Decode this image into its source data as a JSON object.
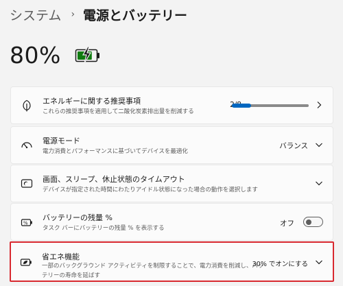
{
  "breadcrumb": {
    "parent": "システム",
    "separator": "›",
    "current": "電源とバッテリー"
  },
  "battery": {
    "percent_text": "80%",
    "level": 0.8,
    "charging": true,
    "accent": "#107c10"
  },
  "cards": {
    "recommendations": {
      "title": "エネルギーに関する推奨事項",
      "desc": "これらの推奨事項を適用して二酸化炭素排出量を削減する",
      "progress_text": "2/8",
      "progress_fraction": 0.25,
      "icon": "leaf-icon"
    },
    "power_mode": {
      "title": "電源モード",
      "desc": "電力消費とパフォーマンスに基づいてデバイスを最適化",
      "value": "バランス",
      "icon": "speedometer-icon"
    },
    "sleep": {
      "title": "画面、スリープ、休止状態のタイムアウト",
      "desc": "デバイスが指定された時間にわたりアイドル状態になった場合の動作を選択します",
      "icon": "monitor-sleep-icon"
    },
    "battery_percentage": {
      "title": "バッテリーの残量 %",
      "desc": "タスク バーにバッテリーの残量 % を表示する",
      "toggle_label": "オフ",
      "toggle_on": false,
      "icon": "battery-percent-icon"
    },
    "energy_saver": {
      "title": "省エネ機能",
      "desc": "一部のバックグラウンド アクティビティを制限することで、電力消費を削減し、バッテリーの寿命を延ばす",
      "value": "30% でオンにする",
      "icon": "battery-saver-icon",
      "highlight_color": "#d8282f"
    }
  },
  "colors": {
    "accent": "#0067c0",
    "background": "#f3f3f3",
    "card": "#fbfbfb"
  }
}
